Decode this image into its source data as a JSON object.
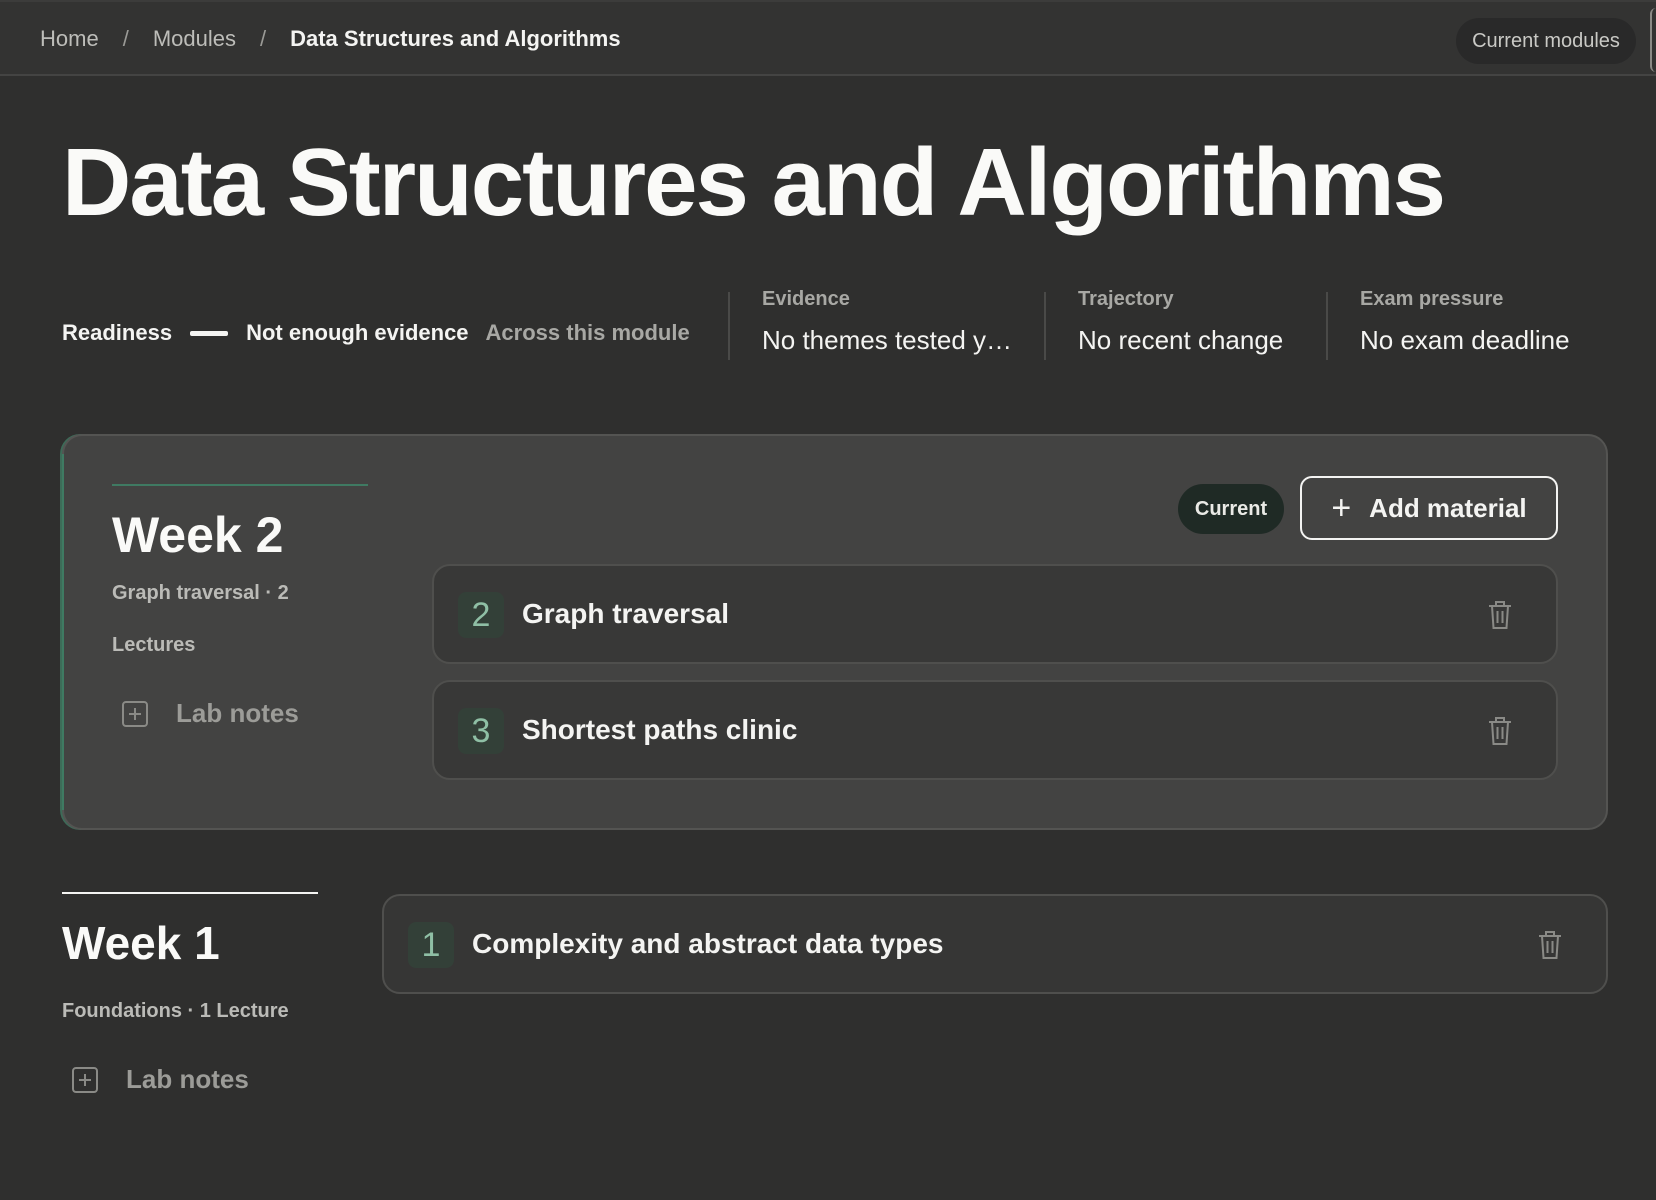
{
  "breadcrumb": {
    "items": [
      "Home",
      "Modules",
      "Data Structures and Algorithms"
    ],
    "separator": "/"
  },
  "header": {
    "current_modules_label": "Current modules"
  },
  "page": {
    "title": "Data Structures and Algorithms"
  },
  "stats": {
    "readiness": {
      "label": "Readiness",
      "value": "Not enough evidence",
      "scope": "Across this module"
    },
    "evidence": {
      "label": "Evidence",
      "value": "No themes tested y…"
    },
    "trajectory": {
      "label": "Trajectory",
      "value": "No recent change"
    },
    "exam_pressure": {
      "label": "Exam pressure",
      "value": "No exam deadline"
    }
  },
  "weeks": [
    {
      "title": "Week 2",
      "meta": "Graph traversal · 2",
      "meta2": "Lectures",
      "lab_notes_label": "Lab notes",
      "status_badge": "Current",
      "add_material_label": "Add material",
      "items": [
        {
          "number": "2",
          "title": "Graph traversal"
        },
        {
          "number": "3",
          "title": "Shortest paths clinic"
        }
      ]
    },
    {
      "title": "Week 1",
      "meta": "Foundations · 1 Lecture",
      "lab_notes_label": "Lab notes",
      "items": [
        {
          "number": "1",
          "title": "Complexity and abstract data types"
        }
      ]
    }
  ],
  "icons": {
    "add": "plus-icon",
    "delete": "trash-icon",
    "lab_notes": "plus-square-icon"
  },
  "colors": {
    "background": "#2f2f2e",
    "accent": "#3f7a62",
    "card": "#434342",
    "badge_bg": "#1f2a25"
  }
}
